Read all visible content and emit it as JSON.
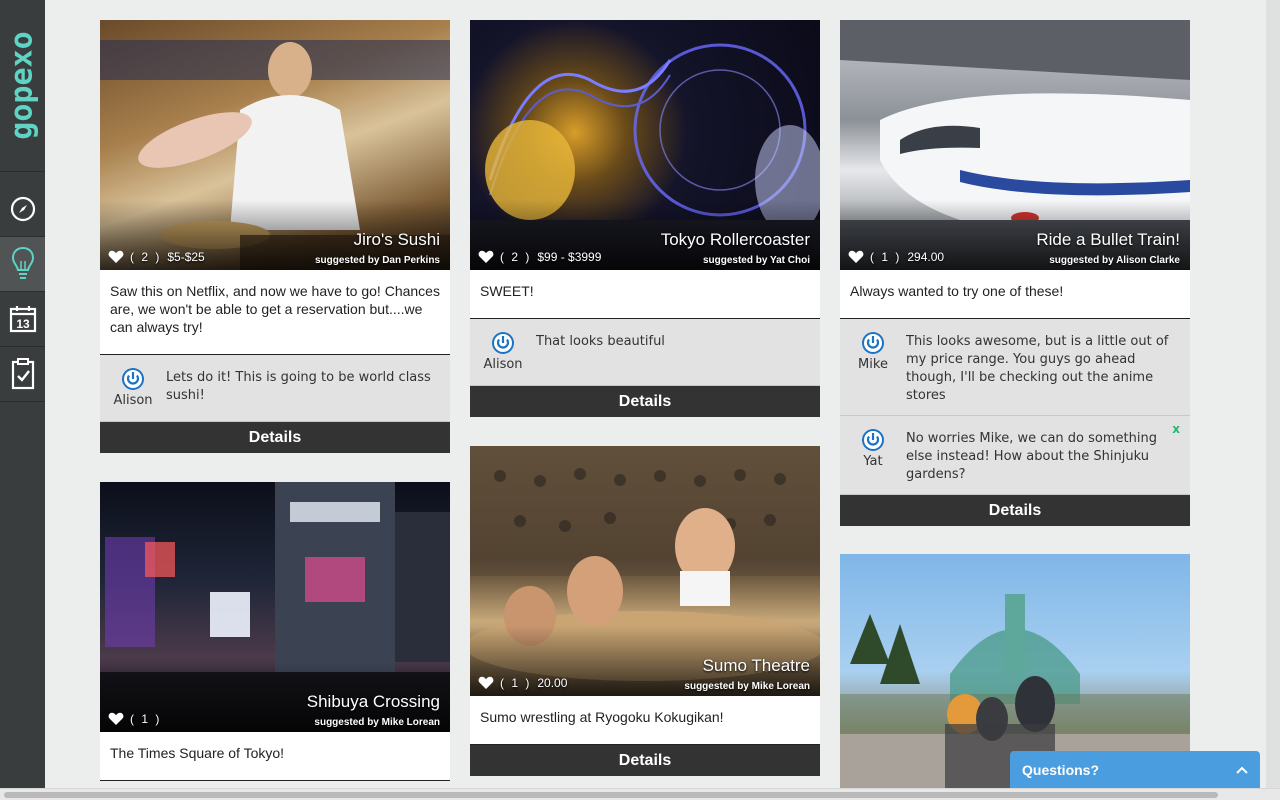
{
  "app": {
    "logo": "gopexo"
  },
  "nav": [
    {
      "icon": "compass-icon",
      "active": false
    },
    {
      "icon": "lightbulb-icon",
      "active": true
    },
    {
      "icon": "calendar-icon",
      "label": "13",
      "active": false
    },
    {
      "icon": "clipboard-check-icon",
      "active": false
    }
  ],
  "cards": [
    {
      "title": "Jiro's Sushi",
      "suggested": "suggested by Dan Perkins",
      "likes": "( 2 )",
      "price": "$5-$25",
      "description": "Saw this on Netflix, and now we have to go! Chances are, we won't be able to get a reservation but....we can always try!",
      "comments": [
        {
          "author": "Alison",
          "text": "Lets do it! This is going to be world class sushi!"
        }
      ],
      "details_label": "Details"
    },
    {
      "title": "Tokyo Rollercoaster",
      "suggested": "suggested by Yat Choi",
      "likes": "( 2 )",
      "price": "$99 - $3999",
      "description": "SWEET!",
      "comments": [
        {
          "author": "Alison",
          "text": "That looks beautiful"
        }
      ],
      "details_label": "Details"
    },
    {
      "title": "Ride a Bullet Train!",
      "suggested": "suggested by Alison Clarke",
      "likes": "( 1 )",
      "price": "294.00",
      "description": "Always wanted to try one of these!",
      "comments": [
        {
          "author": "Mike",
          "text": "This looks awesome, but is a little out of my price range. You guys go ahead though, I'll be checking out the anime stores"
        },
        {
          "author": "Yat",
          "text": "No worries Mike, we can do something else instead! How about the Shinjuku gardens?",
          "close": "x"
        }
      ],
      "details_label": "Details"
    },
    {
      "title": "Shibuya Crossing",
      "suggested": "suggested by Mike Lorean",
      "likes": "( 1 )",
      "price": "",
      "description": "The Times Square of Tokyo!"
    },
    {
      "title": "Sumo Theatre",
      "suggested": "suggested by Mike Lorean",
      "likes": "( 1 )",
      "price": "20.00",
      "description": "Sumo wrestling at Ryogoku Kokugikan!",
      "details_label": "Details"
    },
    {
      "title": "",
      "suggested": ""
    }
  ],
  "questions": {
    "label": "Questions?",
    "icon": "chevron-up-icon"
  },
  "colors": {
    "accent": "#5fd3c4",
    "sidebar": "#3a3d3e",
    "details_bar": "#333333",
    "widget": "#4a9ddf"
  }
}
